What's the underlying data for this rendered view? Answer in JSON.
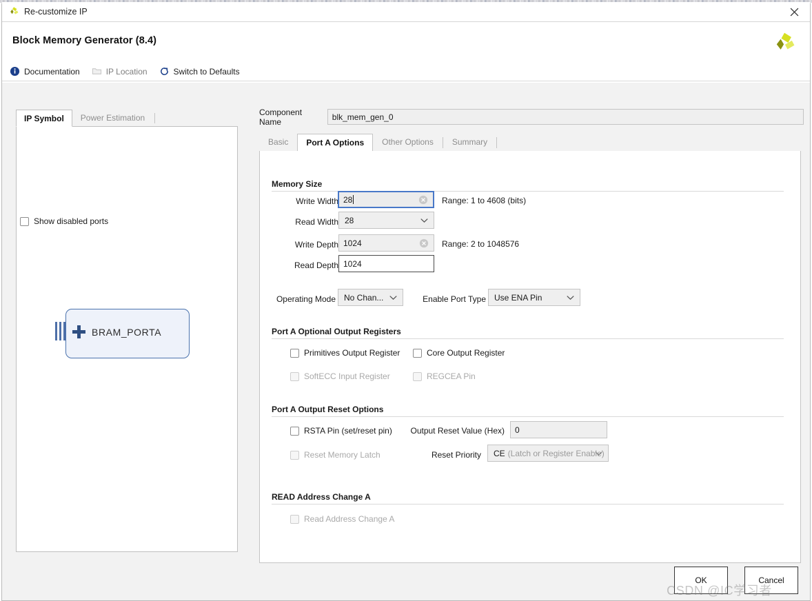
{
  "window": {
    "title": "Re-customize IP",
    "close_icon": "close-icon",
    "app_icon": "xilinx-logo-icon"
  },
  "header": {
    "product_title": "Block Memory Generator (8.4)",
    "logo_icon": "xilinx-pinwheel-logo"
  },
  "toolbar": {
    "items": [
      {
        "label": "Documentation",
        "icon": "info-circle-icon",
        "disabled": false
      },
      {
        "label": "IP Location",
        "icon": "folder-icon",
        "disabled": true
      },
      {
        "label": "Switch to Defaults",
        "icon": "refresh-icon",
        "disabled": false
      }
    ]
  },
  "left_panel": {
    "tabs": [
      {
        "label": "IP Symbol",
        "active": true
      },
      {
        "label": "Power Estimation",
        "active": false
      }
    ],
    "show_disabled_ports": {
      "label": "Show disabled ports",
      "checked": false
    },
    "symbol": {
      "block_label": "BRAM_PORTA",
      "expand_icon": "plus-icon",
      "bus_icon": "bus-stub-icon"
    }
  },
  "component": {
    "label": "Component Name",
    "value": "blk_mem_gen_0"
  },
  "tabs": [
    {
      "label": "Basic",
      "active": false
    },
    {
      "label": "Port A Options",
      "active": true
    },
    {
      "label": "Other Options",
      "active": false
    },
    {
      "label": "Summary",
      "active": false
    }
  ],
  "memory_size": {
    "heading": "Memory Size",
    "write_width": {
      "label": "Write Width",
      "value": "28",
      "focused": true,
      "clear_icon": "clear-circle-icon",
      "range": "Range: 1 to 4608 (bits)"
    },
    "read_width": {
      "label": "Read Width",
      "value": "28",
      "chevron_icon": "chevron-down-icon"
    },
    "write_depth": {
      "label": "Write Depth",
      "value": "1024",
      "clear_icon": "clear-circle-icon",
      "range": "Range: 2 to 1048576"
    },
    "read_depth": {
      "label": "Read Depth",
      "value": "1024"
    }
  },
  "mode_row": {
    "operating_mode": {
      "label": "Operating Mode",
      "value": "No Chan...",
      "chevron_icon": "chevron-down-icon"
    },
    "enable_port_type": {
      "label": "Enable Port Type",
      "value": "Use ENA Pin",
      "chevron_icon": "chevron-down-icon"
    }
  },
  "optional_output_registers": {
    "heading": "Port A Optional Output Registers",
    "checkboxes": [
      {
        "label": "Primitives Output Register",
        "checked": false,
        "disabled": false
      },
      {
        "label": "Core Output Register",
        "checked": false,
        "disabled": false
      },
      {
        "label": "SoftECC Input Register",
        "checked": false,
        "disabled": true
      },
      {
        "label": "REGCEA Pin",
        "checked": false,
        "disabled": true
      }
    ]
  },
  "output_reset_options": {
    "heading": "Port A Output Reset Options",
    "rsta_pin": {
      "label": "RSTA Pin (set/reset pin)",
      "checked": false,
      "disabled": false
    },
    "reset_memory_latch": {
      "label": "Reset Memory Latch",
      "checked": false,
      "disabled": true
    },
    "output_reset_value": {
      "label": "Output Reset Value (Hex)",
      "value": "0"
    },
    "reset_priority": {
      "label": "Reset Priority",
      "value": "CE",
      "value_sub": "(Latch or Register Enable)",
      "chevron_icon": "chevron-down-icon"
    }
  },
  "read_address_change": {
    "heading": "READ Address Change A",
    "checkbox": {
      "label": "Read Address Change A",
      "checked": false,
      "disabled": true
    }
  },
  "footer": {
    "ok_label": "OK",
    "cancel_label": "Cancel"
  },
  "watermark": {
    "text": "CSDN @IC学习者"
  }
}
